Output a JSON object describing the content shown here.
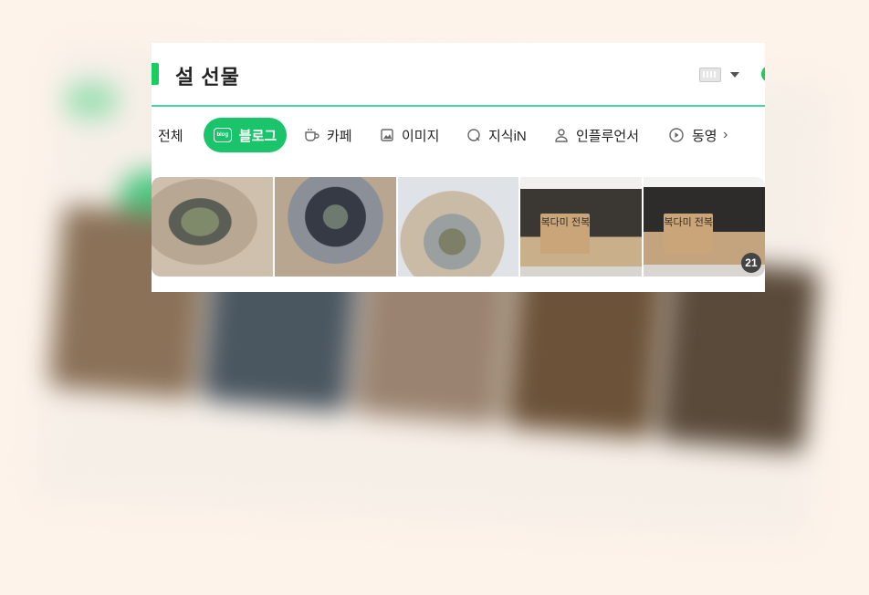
{
  "search": {
    "query": "설 선물"
  },
  "tabs": {
    "all": "전체",
    "blog": "블로그",
    "blog_badge": "blog",
    "cafe": "카페",
    "image": "이미지",
    "kin": "지식iN",
    "influencer": "인플루언서",
    "video": "동영"
  },
  "results": {
    "image_count_badge": "21",
    "label_4": "복다미 전복",
    "label_5": "복다미 전복"
  },
  "colors": {
    "accent_green": "#19ce60",
    "underline": "#47d3a0",
    "blog_tab": "#19c46b"
  }
}
